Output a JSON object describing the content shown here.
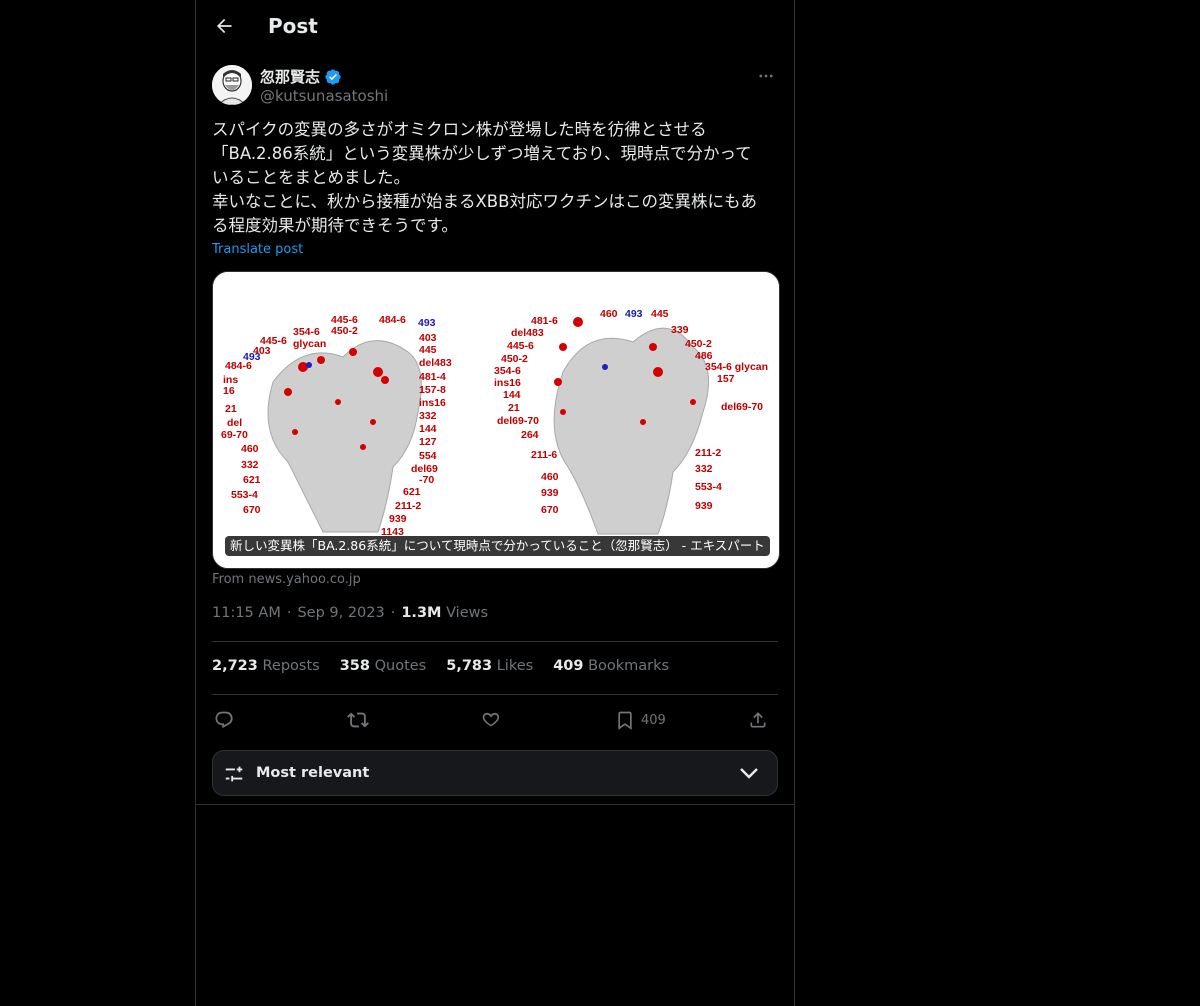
{
  "header": {
    "title": "Post"
  },
  "author": {
    "name": "忽那賢志",
    "handle": "@kutsunasatoshi",
    "verified": true
  },
  "post": {
    "text": "スパイクの変異の多さがオミクロン株が登場した時を彷彿とさせる\n「BA.2.86系統」という変異株が少しずつ増えており、現時点で分かって\nいることをまとめました。\n幸いなことに、秋から接種が始まるXBB対応ワクチンはこの変異株にもあ\nる程度効果が期待できそうです。",
    "translate_label": "Translate post"
  },
  "card": {
    "caption": "新しい変異株「BA.2.86系統」について現時点で分かっていること（忽那賢志） - エキスパート",
    "source": "From news.yahoo.co.jp",
    "left_labels": [
      "354-6",
      "glycan",
      "445-6",
      "450-2",
      "484-6",
      "493",
      "445-6",
      "403",
      "484-6",
      "493",
      "ins",
      "16",
      "21",
      "del",
      "69-70",
      "460",
      "332",
      "621",
      "553-4",
      "670",
      "403",
      "445",
      "del483",
      "481-4",
      "157-8",
      "ins16",
      "332",
      "144",
      "127",
      "554",
      "del69",
      "-70",
      "621",
      "211-2",
      "939",
      "1143"
    ],
    "right_labels": [
      "481-6",
      "460",
      "493",
      "445",
      "del483",
      "339",
      "445-6",
      "450-2",
      "450-2",
      "486",
      "354-6",
      "354-6 glycan",
      "ins16",
      "157",
      "144",
      "21",
      "del69-70",
      "del69-70",
      "264",
      "211-6",
      "211-2",
      "332",
      "460",
      "553-4",
      "939",
      "670",
      "939"
    ]
  },
  "meta": {
    "time": "11:15 AM",
    "date": "Sep 9, 2023",
    "views_count": "1.3M",
    "views_label": "Views",
    "sep": "·"
  },
  "stats": {
    "reposts_count": "2,723",
    "reposts_label": "Reposts",
    "quotes_count": "358",
    "quotes_label": "Quotes",
    "likes_count": "5,783",
    "likes_label": "Likes",
    "bookmarks_count": "409",
    "bookmarks_label": "Bookmarks"
  },
  "actions": {
    "bookmark_count": "409"
  },
  "sort": {
    "label": "Most relevant"
  },
  "icons": {
    "back": "arrow-left-icon",
    "more": "more-horizontal-icon",
    "verified": "verified-badge-icon",
    "reply": "reply-icon",
    "repost": "repost-icon",
    "like": "heart-icon",
    "bookmark": "bookmark-icon",
    "share": "share-icon",
    "sort": "sliders-icon",
    "chevron": "chevron-down-icon"
  },
  "colors": {
    "accent": "#1d9bf0",
    "text": "#e7e9ea",
    "muted": "#71767b",
    "border": "#2f3336",
    "label_red": "#c00000",
    "label_blue": "#1a1aa8"
  }
}
